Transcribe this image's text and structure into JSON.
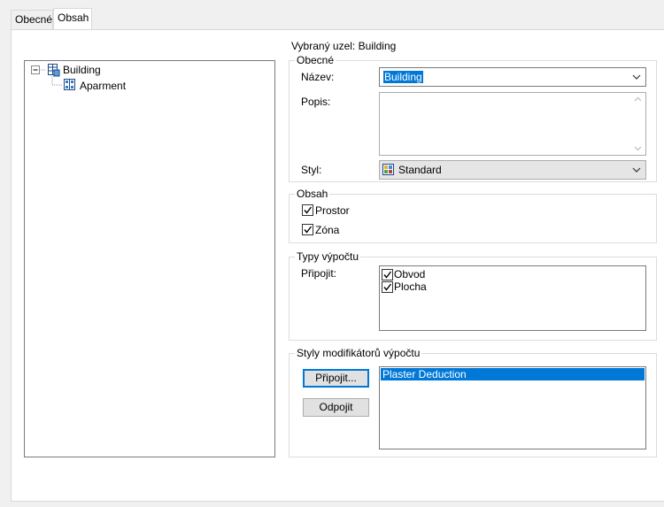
{
  "tabs": [
    {
      "label": "Obecné",
      "active": false
    },
    {
      "label": "Obsah",
      "active": true
    }
  ],
  "tree": {
    "root": {
      "label": "Building",
      "expanded": true
    },
    "children": [
      {
        "label": "Aparment"
      }
    ]
  },
  "selected_node": "Vybraný uzel: Building",
  "general": {
    "legend": "Obecné",
    "name_label": "Název:",
    "name_value": "Building",
    "desc_label": "Popis:",
    "desc_value": "",
    "style_label": "Styl:",
    "style_value": "Standard"
  },
  "content": {
    "legend": "Obsah",
    "items": [
      {
        "label": "Prostor",
        "checked": true
      },
      {
        "label": "Zóna",
        "checked": true
      }
    ]
  },
  "calc_types": {
    "legend": "Typy výpočtu",
    "attach_label": "Připojit:",
    "items": [
      {
        "label": "Obvod",
        "checked": true
      },
      {
        "label": "Plocha",
        "checked": true
      }
    ]
  },
  "modifiers": {
    "legend": "Styly modifikátorů výpočtu",
    "attach_button": "Připojit...",
    "detach_button": "Odpojit",
    "items": [
      {
        "label": "Plaster Deduction",
        "selected": true
      }
    ]
  },
  "colors": {
    "accent": "#0078d7",
    "panel_bg": "#ffffff",
    "window_bg": "#f0f0f0"
  }
}
